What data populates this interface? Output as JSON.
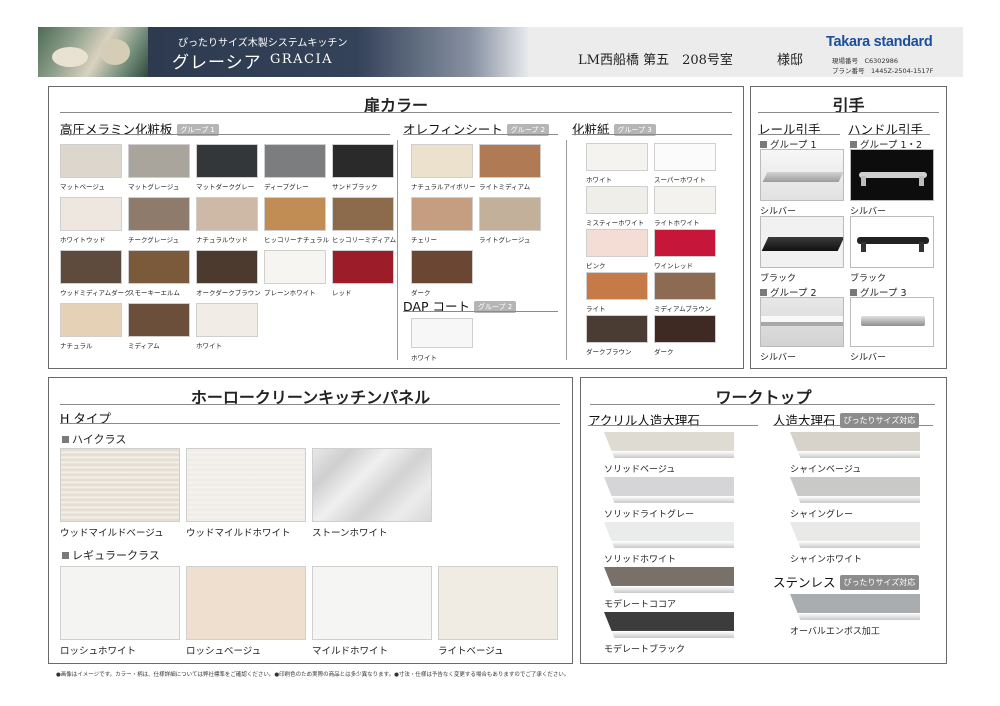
{
  "header": {
    "subtitle": "ぴったりサイズ木製システムキッチン",
    "title": "グレーシア",
    "title_en": "GRACIA",
    "property": "LM西船橋 第五　208号室",
    "honorific": "様邸",
    "brand": "Takara standard",
    "site_no": "現場番号　C6302986",
    "plan_no": "プラン番号　1445Z-2504-1517F"
  },
  "door": {
    "title": "扉カラー",
    "melamine": {
      "heading": "高圧メラミン化粧板",
      "badge": "グループ 1",
      "items": [
        {
          "name": "マットベージュ",
          "color": "#ddd6cc"
        },
        {
          "name": "マットグレージュ",
          "color": "#a9a49c"
        },
        {
          "name": "マットダークグレー",
          "color": "#333739"
        },
        {
          "name": "ディープグレー",
          "color": "#7c7d7e"
        },
        {
          "name": "サンドブラック",
          "color": "#2b2a2b"
        },
        {
          "name": "ホワイトウッド",
          "color": "#eee7df"
        },
        {
          "name": "チークグレージュ",
          "color": "#8f7b6c"
        },
        {
          "name": "ナチュラルウッド",
          "color": "#cdb9a5"
        },
        {
          "name": "ヒッコリーナチュラル",
          "color": "#c28c55"
        },
        {
          "name": "ヒッコリーミディアム",
          "color": "#8c6a4c"
        },
        {
          "name": "ウッドミディアムダーク",
          "color": "#5f4b3e"
        },
        {
          "name": "スモーキーエルム",
          "color": "#7a5a3a"
        },
        {
          "name": "オークダークブラウン",
          "color": "#4b3a2d"
        },
        {
          "name": "プレーンホワイト",
          "color": "#f6f5f2"
        },
        {
          "name": "レッド",
          "color": "#9c1c2a"
        },
        {
          "name": "ナチュラル",
          "color": "#e5d1b5"
        },
        {
          "name": "ミディアム",
          "color": "#6b4f3a"
        },
        {
          "name": "ホワイト",
          "color": "#f1ece6"
        }
      ]
    },
    "olefin": {
      "heading": "オレフィンシート",
      "badge": "グループ 2",
      "items": [
        {
          "name": "ナチュラルアイボリー",
          "color": "#ece1cc"
        },
        {
          "name": "ライトミディアム",
          "color": "#b07a55"
        },
        {
          "name": "チェリー",
          "color": "#c59e82"
        },
        {
          "name": "ライトグレージュ",
          "color": "#c2b09a"
        },
        {
          "name": "ダーク",
          "color": "#6b4733"
        }
      ]
    },
    "dap": {
      "heading": "DAP コート",
      "badge": "グループ 2",
      "items": [
        {
          "name": "ホワイト",
          "color": "#f7f7f7"
        }
      ]
    },
    "paper": {
      "heading": "化粧紙",
      "badge": "グループ 3",
      "items": [
        {
          "name": "ホワイト",
          "color": "#f4f3f0"
        },
        {
          "name": "スーパーホワイト",
          "color": "#fbfbfb"
        },
        {
          "name": "ミスティーホワイト",
          "color": "#f0eee8"
        },
        {
          "name": "ライトホワイト",
          "color": "#f3f2ee"
        },
        {
          "name": "ピンク",
          "color": "#f3ddd5"
        },
        {
          "name": "ワインレッド",
          "color": "#c6163a"
        },
        {
          "name": "ライト",
          "color": "#c67a47"
        },
        {
          "name": "ミディアムブラウン",
          "color": "#8c6b52"
        },
        {
          "name": "ダークブラウン",
          "color": "#4a3c33"
        },
        {
          "name": "ダーク",
          "color": "#3e2a22"
        }
      ]
    }
  },
  "handle": {
    "title": "引手",
    "rail": "レール引手",
    "bar": "ハンドル引手",
    "group_rail_1": "グループ 1",
    "group_bar_12": "グループ 1・2",
    "group_rail_2": "グループ 2",
    "group_bar_3": "グループ 3",
    "items": {
      "rail_silver": "シルバー",
      "bar_silver": "シルバー",
      "rail_black": "ブラック",
      "bar_black": "ブラック",
      "rail2_silver": "シルバー",
      "bar3_silver": "シルバー"
    }
  },
  "panel": {
    "title": "ホーロークリーンキッチンパネル",
    "type": "H タイプ",
    "high": "ハイクラス",
    "regular": "レギュラークラス",
    "high_items": [
      {
        "name": "ウッドマイルドベージュ",
        "color": "#e6ded3"
      },
      {
        "name": "ウッドマイルドホワイト",
        "color": "#f0ece7"
      },
      {
        "name": "ストーンホワイト",
        "color": "#dcdcdc"
      }
    ],
    "regular_items": [
      {
        "name": "ロッシュホワイト",
        "color": "#f4f4f2"
      },
      {
        "name": "ロッシュベージュ",
        "color": "#eedfcf"
      },
      {
        "name": "マイルドホワイト",
        "color": "#f5f5f3"
      },
      {
        "name": "ライトベージュ",
        "color": "#f1ece3"
      }
    ]
  },
  "worktop": {
    "title": "ワークトップ",
    "acrylic": "アクリル人造大理石",
    "artificial": "人造大理石",
    "fit_badge": "ぴったりサイズ対応",
    "stainless": "ステンレス",
    "acrylic_items": [
      {
        "name": "ソリッドベージュ",
        "color": "#dedbd3"
      },
      {
        "name": "ソリッドライトグレー",
        "color": "#d5d4d6"
      },
      {
        "name": "ソリッドホワイト",
        "color": "#eaeceb"
      },
      {
        "name": "モデレートココア",
        "color": "#7a706a"
      },
      {
        "name": "モデレートブラック",
        "color": "#3c3c3d"
      }
    ],
    "artificial_items": [
      {
        "name": "シャインベージュ",
        "color": "#d7d2ca"
      },
      {
        "name": "シャイングレー",
        "color": "#c9c9c8"
      },
      {
        "name": "シャインホワイト",
        "color": "#e9e9e8"
      }
    ],
    "stainless_items": [
      {
        "name": "オーバルエンボス加工",
        "color": "#a9adaf"
      }
    ]
  },
  "footer": "●画像はイメージです。カラー・柄は、仕様詳細については弊社標準をご確認ください。●印刷色のため実際の商品とは多少異なります。●寸法・仕様は予告なく変更する場合もありますのでご了承ください。"
}
